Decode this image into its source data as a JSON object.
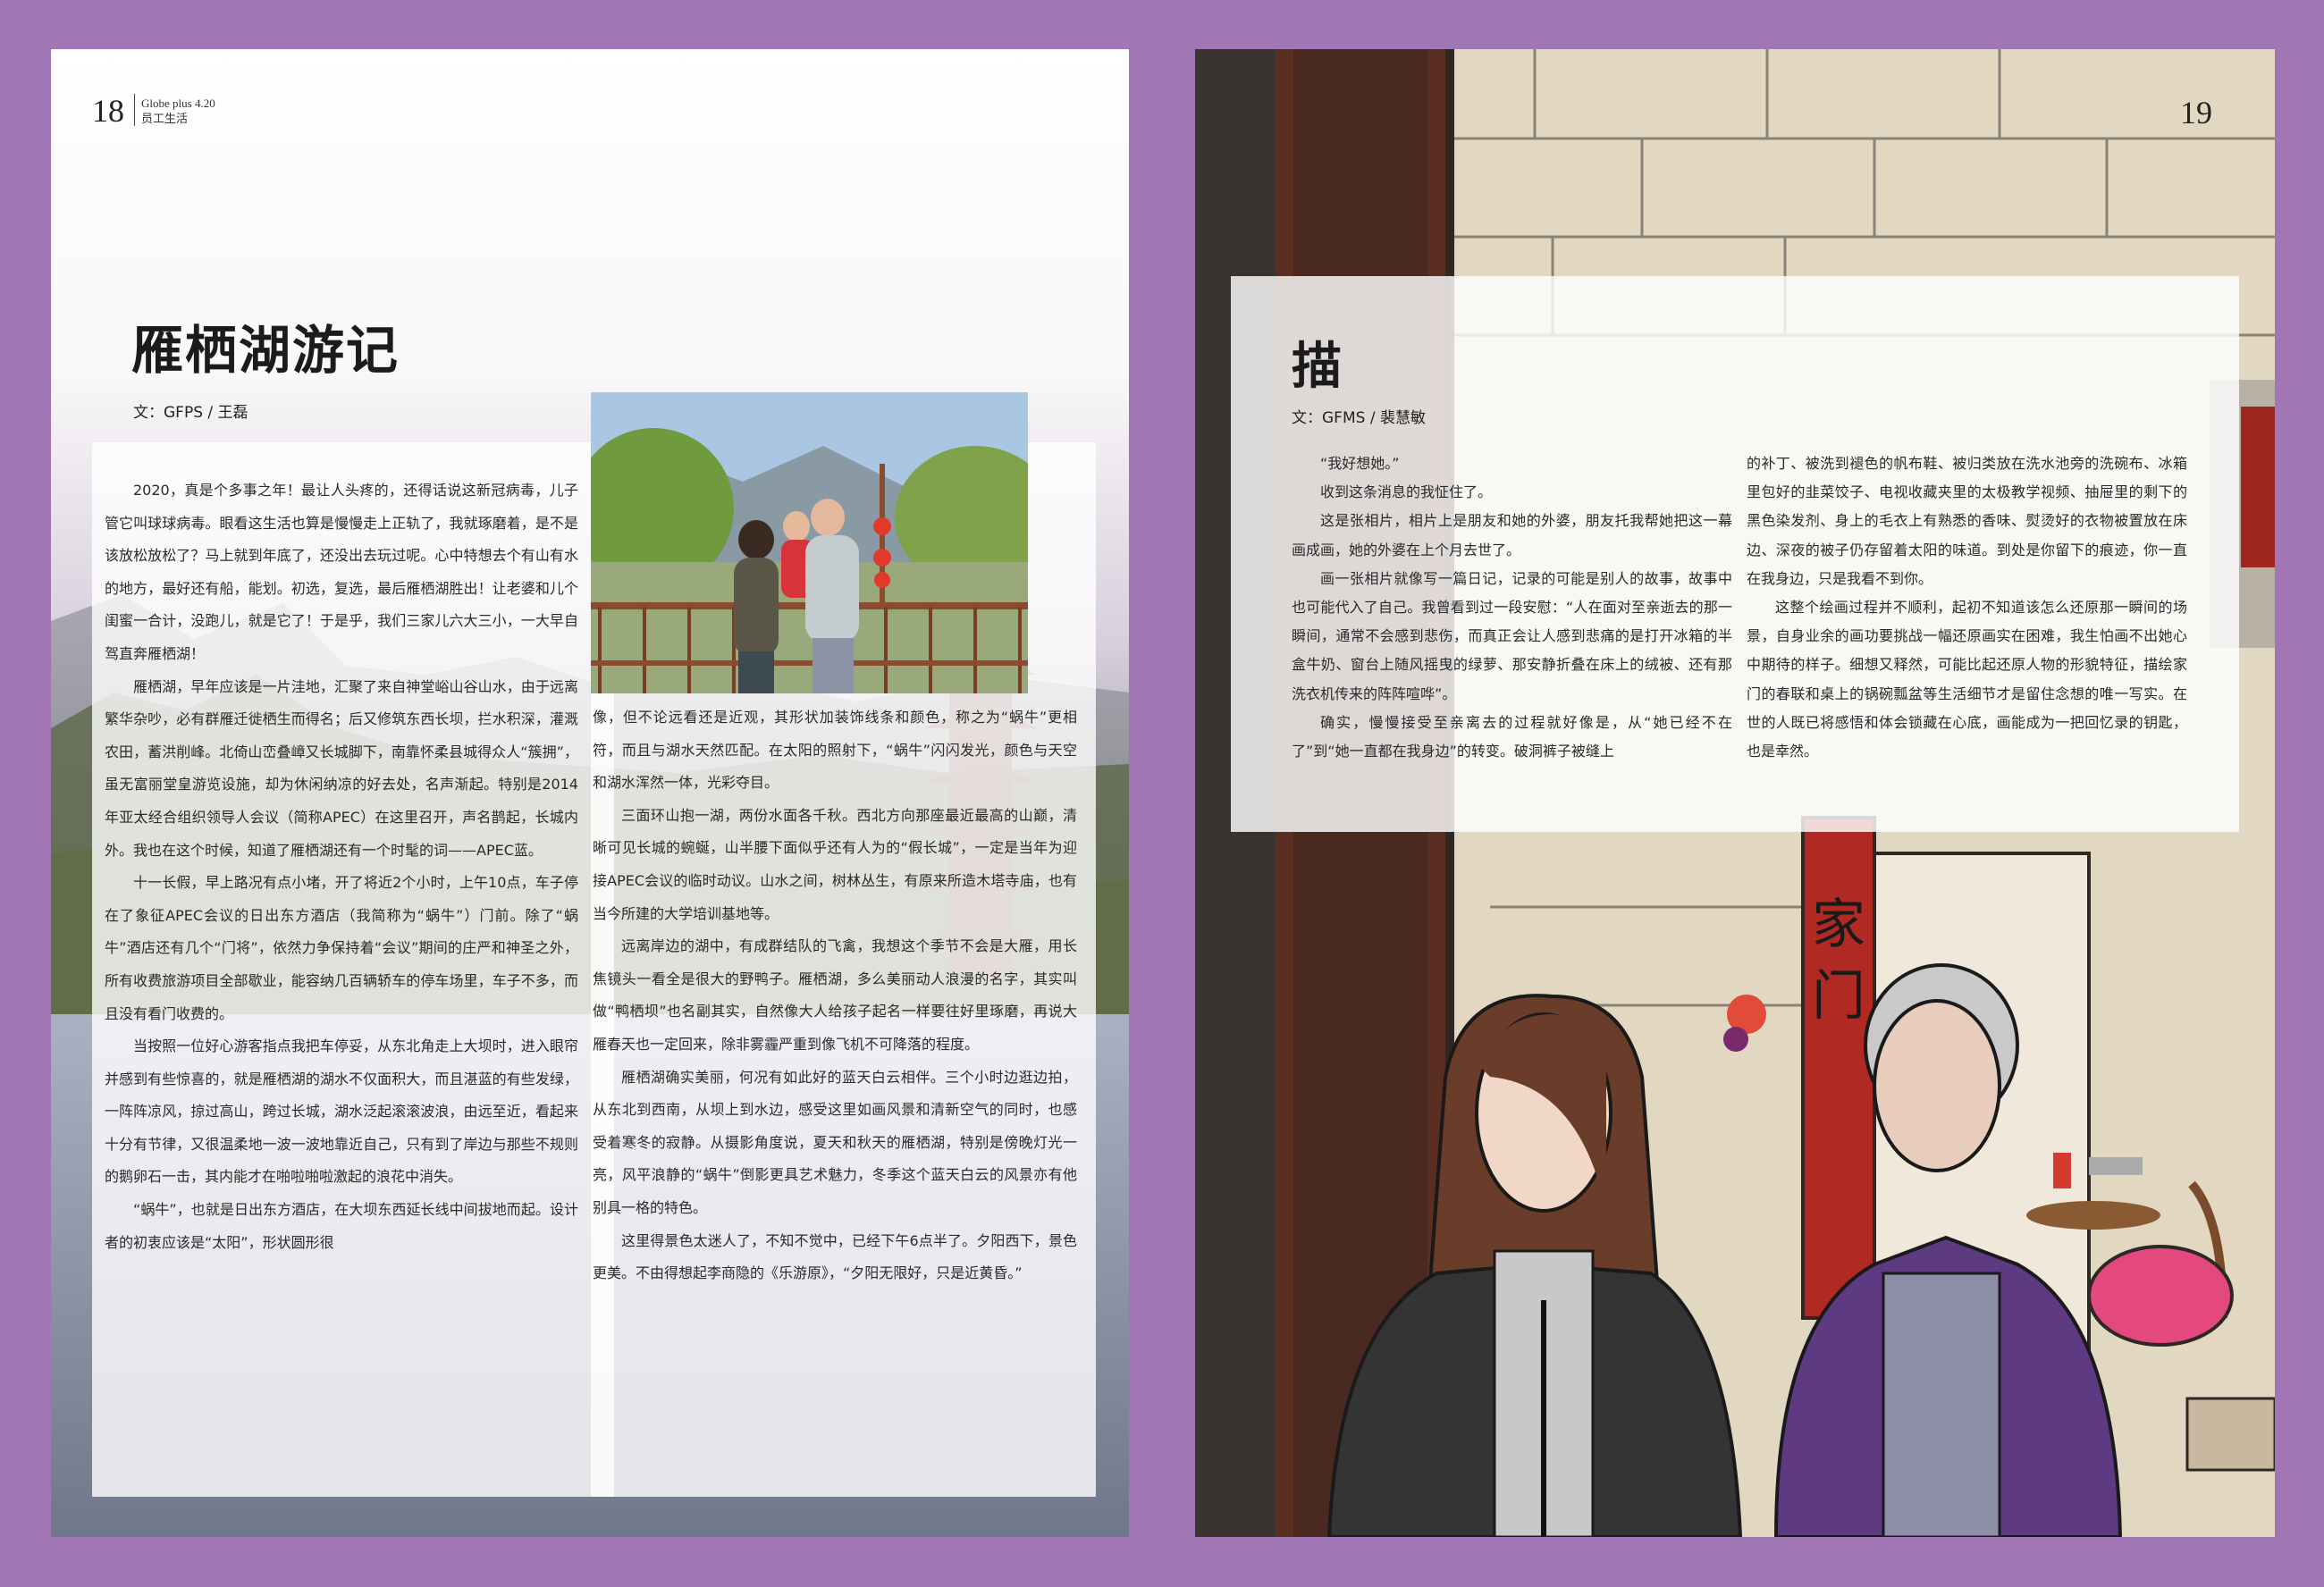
{
  "left_page": {
    "page_number": "18",
    "magazine_name": "Globe plus 4.20",
    "section": "员工生活",
    "title": "雁栖湖游记",
    "byline": "文：GFPS / 王磊",
    "col1": [
      "2020，真是个多事之年！最让人头疼的，还得话说这新冠病毒，儿子管它叫球球病毒。眼看这生活也算是慢慢走上正轨了，我就琢磨着，是不是该放松放松了？马上就到年底了，还没出去玩过呢。心中特想去个有山有水的地方，最好还有船，能划。初选，复选，最后雁栖湖胜出！让老婆和儿个闺蜜一合计，没跑儿，就是它了！于是乎，我们三家儿六大三小，一大早自驾直奔雁栖湖！",
      "雁栖湖，早年应该是一片洼地，汇聚了来自神堂峪山谷山水，由于远离繁华杂吵，必有群雁迁徙栖生而得名；后又修筑东西长坝，拦水积深，灌溉农田，蓄洪削峰。北倚山峦叠嶂又长城脚下，南靠怀柔县城得众人“簇拥”，虽无富丽堂皇游览设施，却为休闲纳凉的好去处，名声渐起。特别是2014年亚太经合组织领导人会议（简称APEC）在这里召开，声名鹊起，长城内外。我也在这个时候，知道了雁栖湖还有一个时髦的词——APEC蓝。",
      "十一长假，早上路况有点小堵，开了将近2个小时，上午10点，车子停在了象征APEC会议的日出东方酒店（我简称为“蜗牛”）门前。除了“蜗牛”酒店还有几个“门将”，依然力争保持着“会议”期间的庄严和神圣之外，所有收费旅游项目全部歇业，能容纳几百辆轿车的停车场里，车子不多，而且没有看门收费的。",
      "当按照一位好心游客指点我把车停妥，从东北角走上大坝时，进入眼帘并感到有些惊喜的，就是雁栖湖的湖水不仅面积大，而且湛蓝的有些发绿，一阵阵凉风，掠过高山，跨过长城，湖水泛起滚滚波浪，由远至近，看起来十分有节律，又很温柔地一波一波地靠近自己，只有到了岸边与那些不规则的鹅卵石一击，其内能才在啪啦啪啦激起的浪花中消失。",
      "“蜗牛”，也就是日出东方酒店，在大坝东西延长线中间拔地而起。设计者的初衷应该是“太阳”，形状圆形很"
    ],
    "col2": [
      "像，但不论远看还是近观，其形状加装饰线条和颜色，称之为“蜗牛”更相符，而且与湖水天然匹配。在太阳的照射下，“蜗牛”闪闪发光，颜色与天空和湖水浑然一体，光彩夺目。",
      "三面环山抱一湖，两份水面各千秋。西北方向那座最近最高的山巅，清晰可见长城的蜿蜒，山半腰下面似乎还有人为的“假长城”，一定是当年为迎接APEC会议的临时动议。山水之间，树林丛生，有原来所造木塔寺庙，也有当今所建的大学培训基地等。",
      "远离岸边的湖中，有成群结队的飞禽，我想这个季节不会是大雁，用长焦镜头一看全是很大的野鸭子。雁栖湖，多么美丽动人浪漫的名字，其实叫做“鸭栖坝”也名副其实，自然像大人给孩子起名一样要往好里琢磨，再说大雁春天也一定回来，除非雾霾严重到像飞机不可降落的程度。",
      "雁栖湖确实美丽，何况有如此好的蓝天白云相伴。三个小时边逛边拍，从东北到西南，从坝上到水边，感受这里如画风景和清新空气的同时，也感受着寒冬的寂静。从摄影角度说，夏天和秋天的雁栖湖，特别是傍晚灯光一亮，风平浪静的“蜗牛”倒影更具艺术魅力，冬季这个蓝天白云的风景亦有他别具一格的特色。",
      "这里得景色太迷人了，不知不觉中，已经下午6点半了。夕阳西下，景色更美。不由得想起李商隐的《乐游原》，“夕阳无限好，只是近黄昏。”"
    ]
  },
  "right_page": {
    "page_number": "19",
    "title": "描",
    "byline": "文：GFMS / 裴慧敏",
    "col1": [
      "“我好想她。”",
      "收到这条消息的我怔住了。",
      "这是张相片，相片上是朋友和她的外婆，朋友托我帮她把这一幕画成画，她的外婆在上个月去世了。",
      "画一张相片就像写一篇日记，记录的可能是别人的故事，故事中也可能代入了自己。我曾看到过一段安慰：“人在面对至亲逝去的那一瞬间，通常不会感到悲伤，而真正会让人感到悲痛的是打开冰箱的半盒牛奶、窗台上随风摇曳的绿萝、那安静折叠在床上的绒被、还有那洗衣机传来的阵阵喧哗”。",
      "确实，慢慢接受至亲离去的过程就好像是，从“她已经不在了”到“她一直都在我身边”的转变。破洞裤子被缝上"
    ],
    "col2": [
      "的补丁、被洗到褪色的帆布鞋、被归类放在洗水池旁的洗碗布、冰箱里包好的韭菜饺子、电视收藏夹里的太极教学视频、抽屉里的剩下的黑色染发剂、身上的毛衣上有熟悉的香味、熨烫好的衣物被置放在床边、深夜的被子仍存留着太阳的味道。到处是你留下的痕迹，你一直在我身边，只是我看不到你。",
      "这整个绘画过程并不顺利，起初不知道该怎么还原那一瞬间的场景，自身业余的画功要挑战一幅还原画实在困难，我生怕画不出她心中期待的样子。细想又释然，可能比起还原人物的形貌特征，描绘家门的春联和桌上的锅碗瓢盆等生活细节才是留住念想的唯一写实。在世的人既已将感悟和体会锁藏在心底，画能成为一把回忆录的钥匙，也是幸然。"
    ],
    "illustration_text": "家门"
  }
}
